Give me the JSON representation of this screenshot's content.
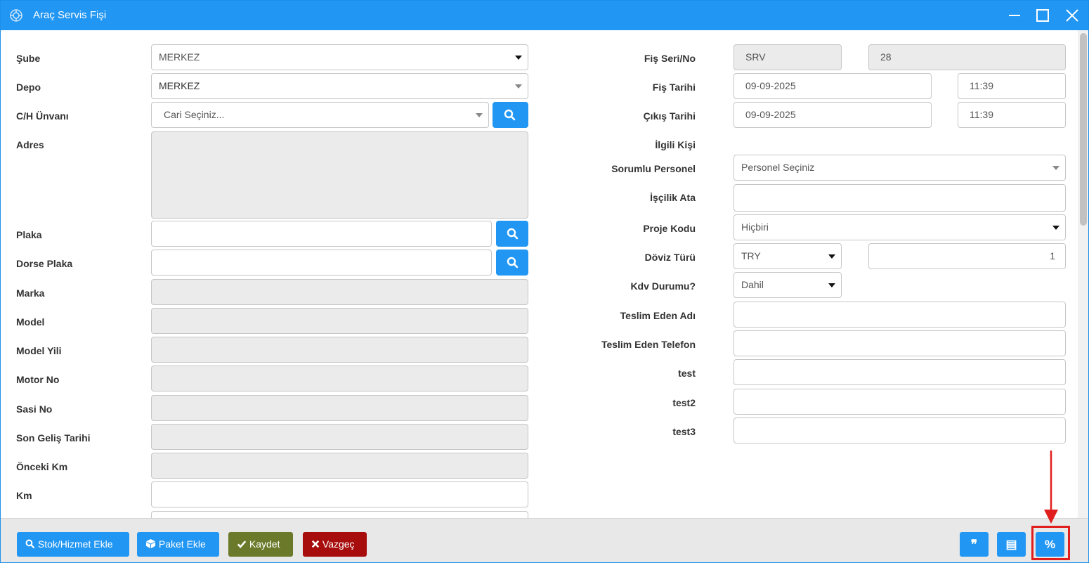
{
  "window": {
    "title": "Araç Servis Fişi",
    "minimize_glyph": "—",
    "maximize_glyph": "☐",
    "close_glyph": "✕"
  },
  "left": {
    "sube": {
      "label": "Şube",
      "value": "MERKEZ"
    },
    "depo": {
      "label": "Depo",
      "value": "MERKEZ"
    },
    "cari": {
      "label": "C/H Ünvanı",
      "placeholder": "Cari Seçiniz..."
    },
    "adres": {
      "label": "Adres",
      "value": ""
    },
    "plaka": {
      "label": "Plaka",
      "value": ""
    },
    "dorse_plaka": {
      "label": "Dorse Plaka",
      "value": ""
    },
    "marka": {
      "label": "Marka",
      "value": ""
    },
    "model": {
      "label": "Model",
      "value": ""
    },
    "model_yili": {
      "label": "Model Yili",
      "value": ""
    },
    "motor_no": {
      "label": "Motor No",
      "value": ""
    },
    "sasi_no": {
      "label": "Sasi No",
      "value": ""
    },
    "son_gelis_tarihi": {
      "label": "Son Geliş Tarihi",
      "value": ""
    },
    "onceki_km": {
      "label": "Önceki Km",
      "value": ""
    },
    "km": {
      "label": "Km",
      "value": ""
    }
  },
  "right": {
    "fis_seri_no": {
      "label": "Fiş Seri/No",
      "seri": "SRV",
      "no": "28"
    },
    "fis_tarihi": {
      "label": "Fiş Tarihi",
      "date": "09-09-2025",
      "time": "11:39"
    },
    "cikis_tarihi": {
      "label": "Çıkış Tarihi",
      "date": "09-09-2025",
      "time": "11:39"
    },
    "ilgili_kisi": {
      "label": "İlgili Kişi"
    },
    "sorumlu_personel": {
      "label": "Sorumlu Personel",
      "value": "Personel Seçiniz"
    },
    "iscilik_ata": {
      "label": "İşçilik Ata",
      "value": ""
    },
    "proje_kodu": {
      "label": "Proje Kodu",
      "value": "Hiçbiri"
    },
    "doviz_turu": {
      "label": "Döviz Türü",
      "value": "TRY",
      "rate": "1"
    },
    "kdv_durumu": {
      "label": "Kdv Durumu?",
      "value": "Dahil"
    },
    "teslim_eden_adi": {
      "label": "Teslim Eden Adı",
      "value": ""
    },
    "teslim_eden_telefon": {
      "label": "Teslim Eden Telefon",
      "value": ""
    },
    "test": {
      "label": "test",
      "value": ""
    },
    "test2": {
      "label": "test2",
      "value": ""
    },
    "test3": {
      "label": "test3",
      "value": ""
    }
  },
  "footer": {
    "stok_hizmet_ekle": "Stok/Hizmet Ekle",
    "paket_ekle": "Paket Ekle",
    "kaydet": "Kaydet",
    "vazgec": "Vazgeç",
    "quote_glyph": "❞",
    "book_glyph": "▤",
    "percent_glyph": "%"
  },
  "colors": {
    "primary": "#2196f3",
    "save": "#6b7a2a",
    "cancel": "#a80d0d",
    "highlight": "#e01e1e",
    "readonly_bg": "#ebebeb"
  }
}
